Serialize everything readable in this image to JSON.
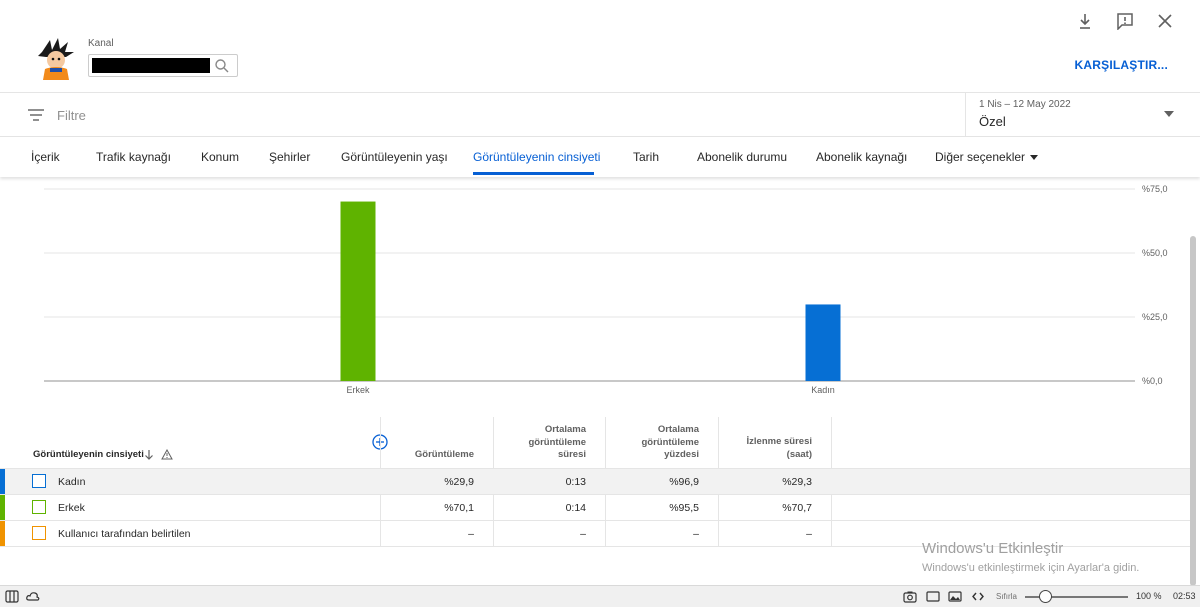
{
  "header": {
    "channel_label": "Kanal",
    "compare_button": "KARŞILAŞTIR..."
  },
  "filter": {
    "placeholder": "Filtre",
    "date_range": "1 Nis – 12 May 2022",
    "date_mode": "Özel"
  },
  "tabs": [
    {
      "label": "İçerik"
    },
    {
      "label": "Trafik kaynağı"
    },
    {
      "label": "Konum"
    },
    {
      "label": "Şehirler"
    },
    {
      "label": "Görüntüleyenin yaşı"
    },
    {
      "label": "Görüntüleyenin cinsiyeti",
      "active": true
    },
    {
      "label": "Tarih"
    },
    {
      "label": "Abonelik durumu"
    },
    {
      "label": "Abonelik kaynağı"
    },
    {
      "label": "Diğer seçenekler"
    }
  ],
  "chart_data": {
    "type": "bar",
    "categories": [
      "Erkek",
      "Kadın"
    ],
    "values": [
      70.1,
      29.9
    ],
    "colors": [
      "#5fb300",
      "#066fd4"
    ],
    "y_ticks": [
      "%0,0",
      "%25,0",
      "%50,0",
      "%75,0"
    ],
    "ylim": [
      0,
      75
    ],
    "grid": true
  },
  "table": {
    "dimension_header": "Görüntüleyenin cinsiyeti",
    "columns": [
      {
        "lines": [
          "Görüntüleme"
        ]
      },
      {
        "lines": [
          "Ortalama",
          "görüntüleme",
          "süresi"
        ]
      },
      {
        "lines": [
          "Ortalama",
          "görüntüleme",
          "yüzdesi"
        ]
      },
      {
        "lines": [
          "İzlenme süresi",
          "(saat)"
        ]
      }
    ],
    "rows": [
      {
        "label": "Kadın",
        "color": "#066fd4",
        "values": [
          "%29,9",
          "0:13",
          "%96,9",
          "%29,3"
        ]
      },
      {
        "label": "Erkek",
        "color": "#5fb300",
        "values": [
          "%70,1",
          "0:14",
          "%95,5",
          "%70,7"
        ]
      },
      {
        "label": "Kullanıcı tarafından belirtilen",
        "color": "#f09300",
        "values": [
          "–",
          "–",
          "–",
          "–"
        ]
      }
    ]
  },
  "watermark": {
    "title": "Windows'u Etkinleştir",
    "subtitle": "Windows'u etkinleştirmek için Ayarlar'a gidin."
  },
  "statusbar": {
    "reset_label": "Sıfırla",
    "zoom": "100 %",
    "time": "02:53"
  }
}
